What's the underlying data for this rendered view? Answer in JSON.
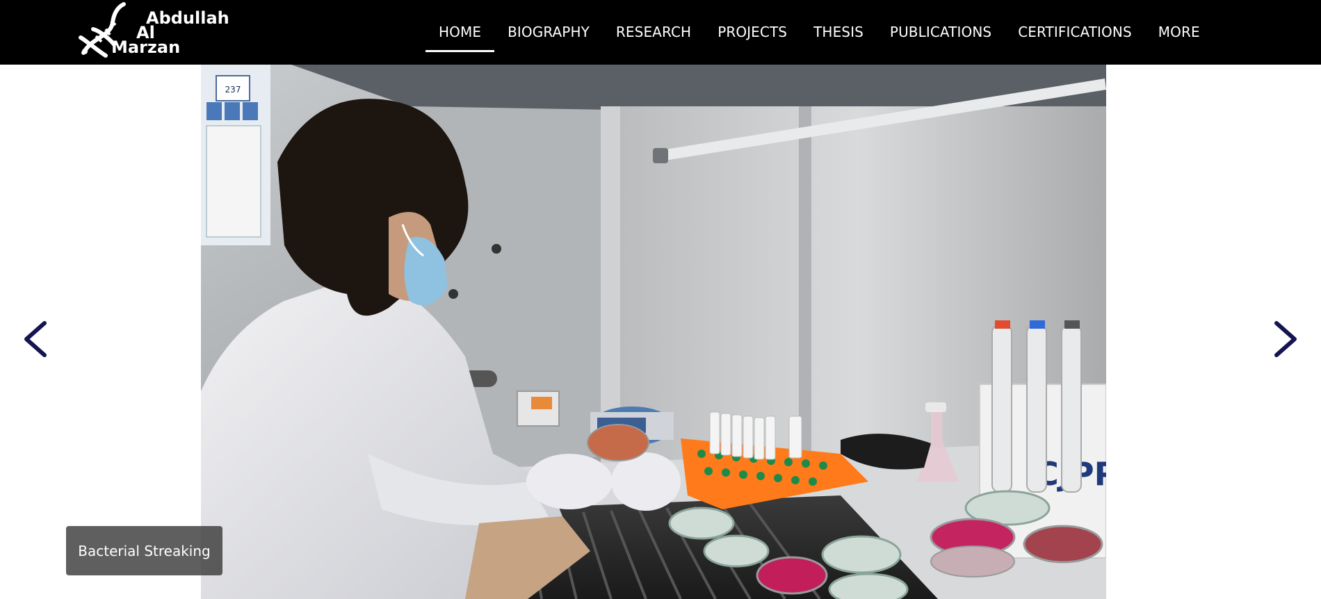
{
  "site": {
    "logo_lines": [
      "Abdullah",
      "Al",
      "Marzan"
    ],
    "logo_icon": "dna-icon"
  },
  "nav": {
    "items": [
      {
        "label": "HOME",
        "active": true
      },
      {
        "label": "BIOGRAPHY",
        "active": false
      },
      {
        "label": "RESEARCH",
        "active": false
      },
      {
        "label": "PROJECTS",
        "active": false
      },
      {
        "label": "THESIS",
        "active": false
      },
      {
        "label": "PUBLICATIONS",
        "active": false
      },
      {
        "label": "CERTIFICATIONS",
        "active": false
      },
      {
        "label": "MORE",
        "active": false
      }
    ]
  },
  "carousel": {
    "caption": "Bacterial Streaking",
    "prev_icon": "chevron-left-icon",
    "next_icon": "chevron-right-icon",
    "arrow_color": "#141450",
    "pipette_brand": "CJPP",
    "sticker_number": "237"
  },
  "colors": {
    "header_bg": "#000000",
    "header_text": "#ffffff",
    "caption_bg": "#3c3c3c"
  }
}
